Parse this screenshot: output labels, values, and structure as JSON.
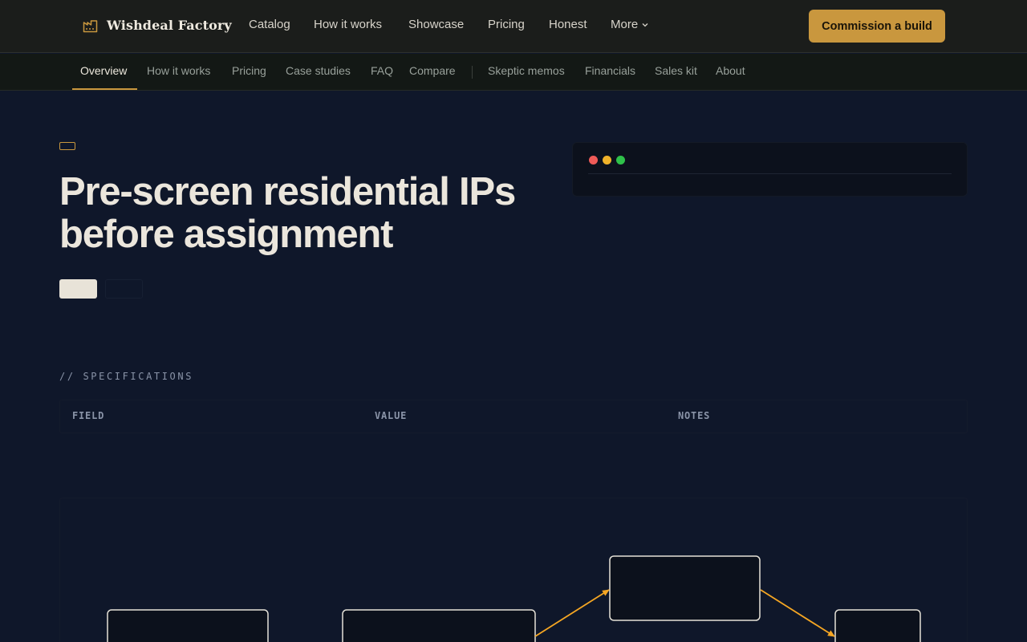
{
  "brand": {
    "name": "Wishdeal Factory",
    "icon": "factory-icon",
    "accent": "#c9973e"
  },
  "topnav": {
    "items": [
      "Catalog",
      "How it works",
      "Showcase",
      "Pricing",
      "Honest"
    ],
    "more_label": "More",
    "cta_label": "Commission a build"
  },
  "subnav": {
    "items": [
      "Overview",
      "How it works",
      "Pricing",
      "Case studies",
      "FAQ",
      "Compare"
    ],
    "secondary_items": [
      "Skeptic memos",
      "Financials",
      "Sales kit",
      "About"
    ],
    "active": "Overview"
  },
  "hero": {
    "title_line1": "Pre-screen residential IPs",
    "title_line2": "before assignment"
  },
  "specs": {
    "label": "// SPECIFICATIONS",
    "columns": [
      "FIELD",
      "VALUE",
      "NOTES"
    ]
  },
  "colors": {
    "background": "#0f172a",
    "topbar": "#1b1d1b",
    "subbar": "#131815",
    "accent": "#c9973e"
  }
}
